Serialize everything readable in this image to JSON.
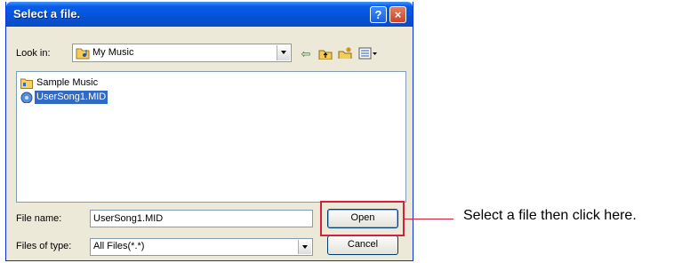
{
  "dialog": {
    "title": "Select a file.",
    "help_symbol": "?",
    "close_symbol": "×",
    "look_in_label": "Look in:",
    "look_in_value": "My Music",
    "toolbar": {
      "back_icon": "back-arrow-icon",
      "up_icon": "up-folder-icon",
      "new_folder_icon": "new-folder-icon",
      "views_icon": "views-menu-icon"
    },
    "files": [
      {
        "name": "Sample Music",
        "icon": "folder-icon",
        "selected": false
      },
      {
        "name": "UserSong1.MID",
        "icon": "midi-file-icon",
        "selected": true
      }
    ],
    "file_name_label": "File name:",
    "file_name_value": "UserSong1.MID",
    "files_type_label": "Files of type:",
    "files_type_value": "All Files(*.*)",
    "open_label": "Open",
    "cancel_label": "Cancel"
  },
  "annotation": {
    "text": "Select a file then click here.",
    "color": "#d4213b"
  },
  "colors": {
    "titlebar": "#0553d8",
    "dialog_bg": "#ece9d8",
    "selection": "#316ac5"
  }
}
